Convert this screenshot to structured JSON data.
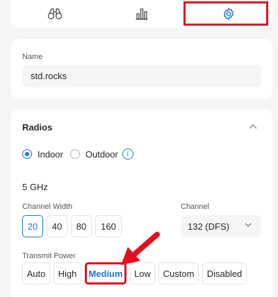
{
  "tabs": [
    {
      "name": "binoculars-icon"
    },
    {
      "name": "bar-chart-icon"
    },
    {
      "name": "gear-icon",
      "active": true
    }
  ],
  "name_section": {
    "label": "Name",
    "value": "std.rocks"
  },
  "radios": {
    "title": "Radios",
    "mode_options": [
      {
        "label": "Indoor",
        "checked": true
      },
      {
        "label": "Outdoor",
        "checked": false
      }
    ],
    "info_glyph": "i",
    "band": "5 GHz",
    "channel_width": {
      "label": "Channel Width",
      "options": [
        "20",
        "40",
        "80",
        "160"
      ],
      "selected": "20"
    },
    "channel": {
      "label": "Channel",
      "value": "132 (DFS)"
    },
    "transmit_power": {
      "label": "Transmit Power",
      "options": [
        "Auto",
        "High",
        "Medium",
        "Low",
        "Custom",
        "Disabled"
      ],
      "selected": "Medium"
    }
  },
  "colors": {
    "accent": "#1a73e8",
    "annotation": "#e0101c",
    "background": "#f4f5f7"
  }
}
